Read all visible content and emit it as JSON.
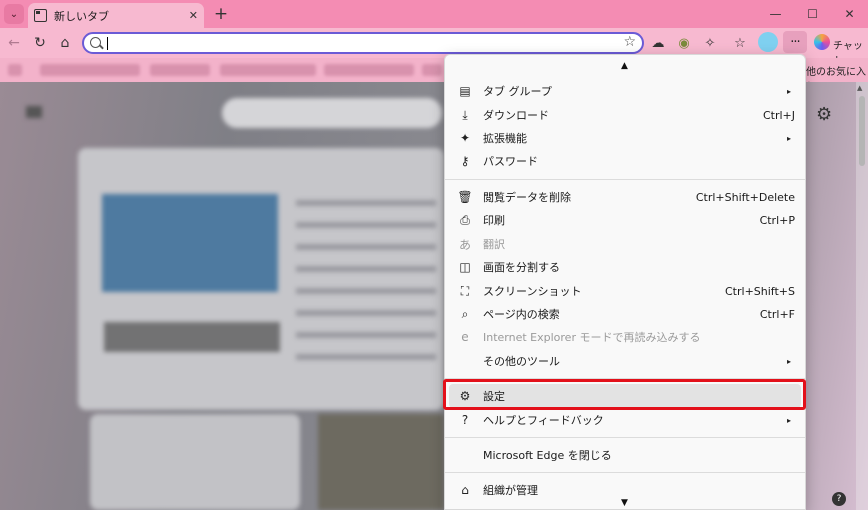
{
  "browser": {
    "tab_title": "新しいタブ",
    "tab_close": "✕",
    "new_tab": "+",
    "window": {
      "minimize": "—",
      "maximize": "☐",
      "close": "✕"
    },
    "address_placeholder": "",
    "chat_label": "チャット",
    "bookmark_last": "他のお気に入り"
  },
  "menu": {
    "items": [
      {
        "icon": "▤",
        "label": "タブ グループ",
        "shortcut": "",
        "arrow": "▸"
      },
      {
        "icon": "⤓",
        "label": "ダウンロード",
        "shortcut": "Ctrl+J",
        "arrow": ""
      },
      {
        "icon": "✦",
        "label": "拡張機能",
        "shortcut": "",
        "arrow": "▸"
      },
      {
        "icon": "⚷",
        "label": "パスワード",
        "shortcut": "",
        "arrow": ""
      },
      {
        "icon": "🗑",
        "label": "閲覧データを削除",
        "shortcut": "Ctrl+Shift+Delete",
        "arrow": ""
      },
      {
        "icon": "⎙",
        "label": "印刷",
        "shortcut": "Ctrl+P",
        "arrow": ""
      },
      {
        "icon": "あ",
        "label": "翻訳",
        "shortcut": "",
        "arrow": ""
      },
      {
        "icon": "◫",
        "label": "画面を分割する",
        "shortcut": "",
        "arrow": ""
      },
      {
        "icon": "⛶",
        "label": "スクリーンショット",
        "shortcut": "Ctrl+Shift+S",
        "arrow": ""
      },
      {
        "icon": "⌕",
        "label": "ページ内の検索",
        "shortcut": "Ctrl+F",
        "arrow": ""
      },
      {
        "icon": "e",
        "label": "Internet Explorer モードで再読み込みする",
        "shortcut": "",
        "arrow": ""
      },
      {
        "icon": "",
        "label": "その他のツール",
        "shortcut": "",
        "arrow": "▸"
      },
      {
        "icon": "⚙",
        "label": "設定",
        "shortcut": "",
        "arrow": ""
      },
      {
        "icon": "?",
        "label": "ヘルプとフィードバック",
        "shortcut": "",
        "arrow": "▸"
      },
      {
        "icon": "",
        "label": "Microsoft Edge を閉じる",
        "shortcut": "",
        "arrow": ""
      },
      {
        "icon": "⌂",
        "label": "組織が管理",
        "shortcut": "",
        "arrow": ""
      }
    ],
    "scroll_up": "▲",
    "scroll_down": "▼"
  }
}
